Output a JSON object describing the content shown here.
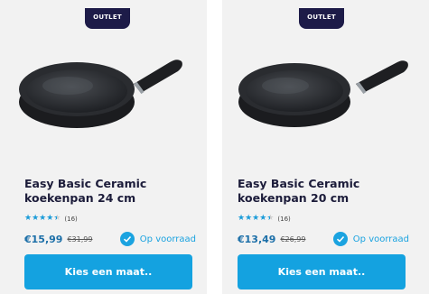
{
  "products": [
    {
      "badge": "OUTLET",
      "title": "Easy Basic Ceramic koekenpan 24 cm",
      "rating": 4.5,
      "review_count": "(16)",
      "price": "€15,99",
      "old_price": "€31,99",
      "stock": "Op voorraad",
      "cta": "Kies een maat.."
    },
    {
      "badge": "OUTLET",
      "title": "Easy Basic Ceramic koekenpan 20 cm",
      "rating": 4.5,
      "review_count": "(16)",
      "price": "€13,49",
      "old_price": "€26,99",
      "stock": "Op voorraad",
      "cta": "Kies een maat.."
    }
  ],
  "colors": {
    "badge_bg": "#1d1b48",
    "accent": "#14a2e0",
    "price": "#1c6fa8"
  },
  "icons": [
    "frying-pan-image",
    "star-icon",
    "check-circle-icon"
  ]
}
